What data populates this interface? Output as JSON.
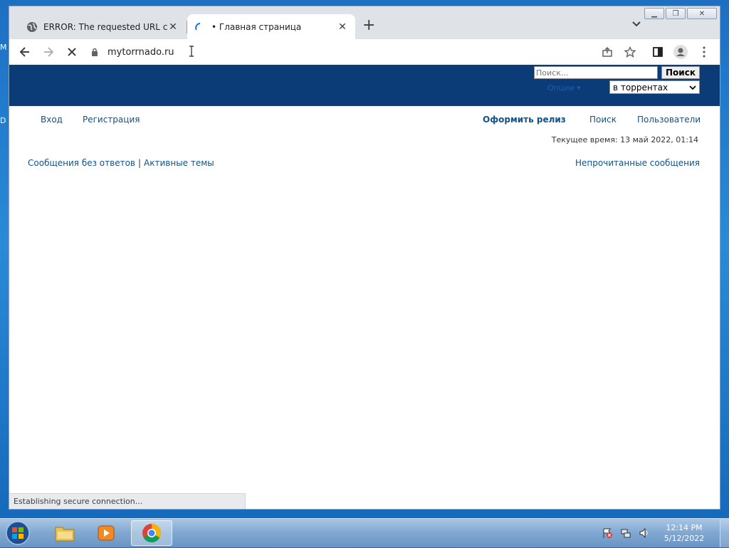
{
  "desktop": {
    "edge_letters": [
      "M",
      "D"
    ]
  },
  "browser": {
    "tabs": [
      {
        "title": "ERROR: The requested URL could not be retrieved",
        "favicon": "globe-icon",
        "close_glyph": "✕"
      },
      {
        "title": "• Главная страница",
        "favicon": "loading-spinner-icon",
        "close_glyph": "✕"
      }
    ],
    "new_tab_glyph": "+",
    "url": "mytorrnado.ru"
  },
  "site": {
    "search": {
      "placeholder": "Поиск…",
      "button": "Поиск"
    },
    "options_label": "Опции ▾",
    "scope_select": {
      "selected": "в торрентах"
    },
    "nav_left": [
      "Вход",
      "Регистрация"
    ],
    "nav_right": [
      "Оформить релиз",
      "Поиск",
      "Пользователи"
    ],
    "current_time": "Текущее время: 13 май 2022, 01:14",
    "quick_links": [
      "Сообщения без ответов",
      "Активные темы"
    ],
    "quick_links_separator": "|",
    "unread_messages": "Непрочитанные сообщения",
    "header_color": "#0c3c78",
    "link_color": "#105289"
  },
  "status_text": "Establishing secure connection...",
  "taskbar": {
    "apps": [
      "file-explorer-icon",
      "media-player-icon",
      "chrome-icon"
    ],
    "clock_time": "12:14 PM",
    "clock_date": "5/12/2022"
  }
}
